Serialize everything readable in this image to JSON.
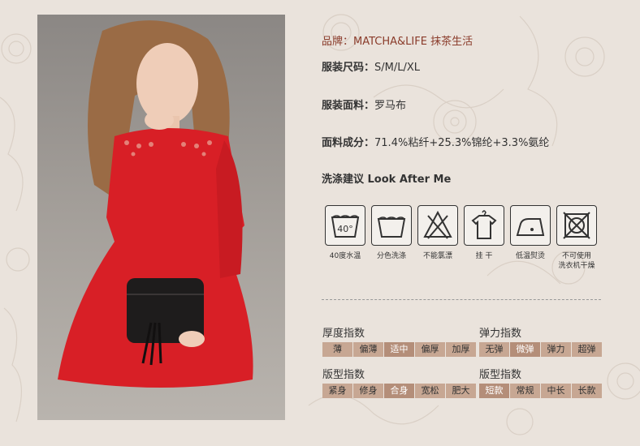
{
  "spec": {
    "brand": {
      "label": "品牌：",
      "value": "MATCHA&LIFE 抹茶生活"
    },
    "size": {
      "label": "服装尺码：",
      "value": "S/M/L/XL"
    },
    "fabric": {
      "label": "服装面料：",
      "value": "罗马布"
    },
    "composition": {
      "label": "面料成分：",
      "value": "71.4%粘纤+25.3%锦纶+3.3%氨纶"
    }
  },
  "care": {
    "title": "洗涤建议 Look After Me",
    "icons": [
      {
        "icon": "wash-40-icon",
        "label": "40度水温",
        "glyph": "40°"
      },
      {
        "icon": "hand-wash-icon",
        "label": "分色洗涤"
      },
      {
        "icon": "no-bleach-icon",
        "label": "不能氯漂"
      },
      {
        "icon": "hang-dry-icon",
        "label": "挂 干"
      },
      {
        "icon": "low-iron-icon",
        "label": "低温熨烫"
      },
      {
        "icon": "no-tumble-dry-icon",
        "label": "不可使用\n洗衣机干燥"
      }
    ]
  },
  "indices": {
    "thickness": {
      "title": "厚度指数",
      "options": [
        "薄",
        "偏薄",
        "适中",
        "偏厚",
        "加厚"
      ],
      "selected": "适中"
    },
    "elasticity": {
      "title": "弹力指数",
      "options": [
        "无弹",
        "微弹",
        "弹力",
        "超弹"
      ],
      "selected": "微弹"
    },
    "fit": {
      "title": "版型指数",
      "options": [
        "紧身",
        "修身",
        "合身",
        "宽松",
        "肥大"
      ],
      "selected": "合身"
    },
    "length": {
      "title": "版型指数",
      "options": [
        "短款",
        "常规",
        "中长",
        "长款"
      ],
      "selected": "短款"
    }
  },
  "colors": {
    "dress": "#d81f26",
    "chip": "#c7a793",
    "chip_selected": "#b48e79",
    "brand": "#8a3b2a"
  }
}
